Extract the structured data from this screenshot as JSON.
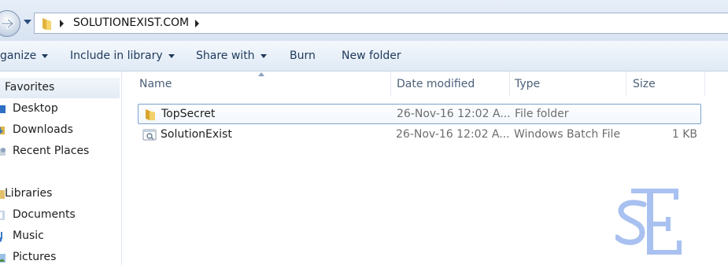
{
  "address": {
    "crumb": "SOLUTIONEXIST.COM"
  },
  "toolbar": {
    "organize": "ganize",
    "include_in_library": "Include in library",
    "share_with": "Share with",
    "burn": "Burn",
    "new_folder": "New folder"
  },
  "nav": {
    "favorites": "Favorites",
    "desktop": "Desktop",
    "downloads": "Downloads",
    "recent_places": "Recent Places",
    "libraries": "Libraries",
    "documents": "Documents",
    "music": "Music",
    "pictures": "Pictures"
  },
  "columns": {
    "name": "Name",
    "date_modified": "Date modified",
    "type": "Type",
    "size": "Size"
  },
  "files": [
    {
      "name": "TopSecret",
      "date": "26-Nov-16 12:02 A...",
      "type": "File folder",
      "size": "",
      "icon": "folder-icon"
    },
    {
      "name": "SolutionExist",
      "date": "26-Nov-16 12:02 A...",
      "type": "Windows Batch File",
      "size": "1 KB",
      "icon": "batch-file-icon"
    }
  ],
  "colors": {
    "accent": "#1e395b",
    "selection_border": "#7da2ce",
    "watermark": "#a9c1f0"
  }
}
